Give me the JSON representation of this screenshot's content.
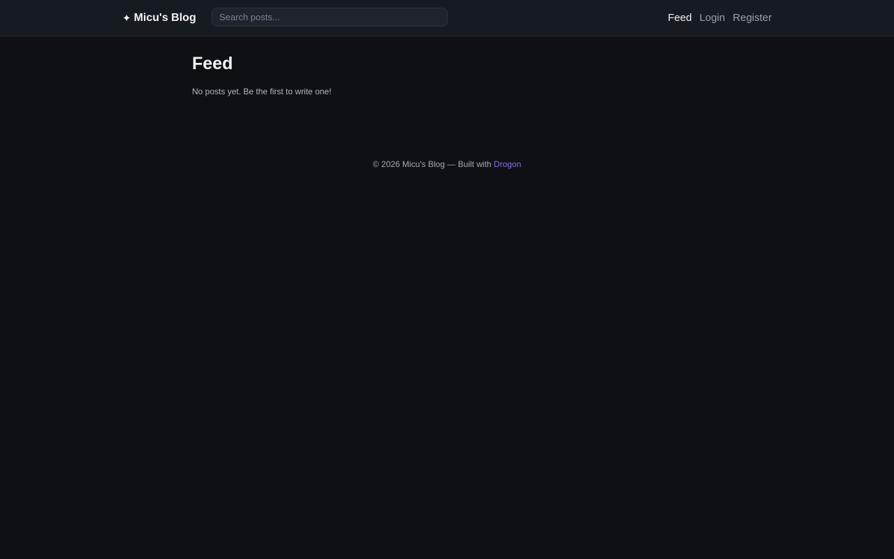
{
  "header": {
    "brand_icon": "✦",
    "brand": "Micu's Blog",
    "search_placeholder": "Search posts...",
    "nav": [
      {
        "label": "Feed",
        "active": true
      },
      {
        "label": "Login",
        "active": false
      },
      {
        "label": "Register",
        "active": false
      }
    ]
  },
  "main": {
    "title": "Feed",
    "empty_message": "No posts yet. Be the first to write one!"
  },
  "footer": {
    "text": "© 2026 Micu's Blog — Built with ",
    "link": "Drogon"
  },
  "colors": {
    "background": "#0e1015",
    "header_bg": "#161a21",
    "accent": "#8b6fe8"
  }
}
